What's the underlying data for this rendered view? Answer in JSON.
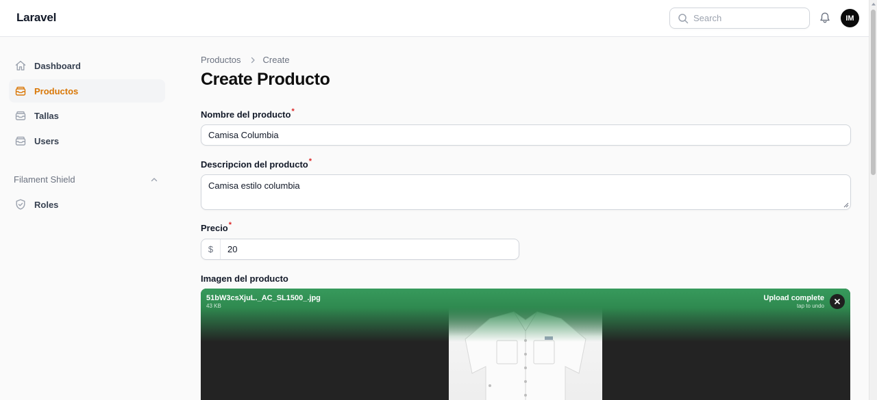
{
  "app": {
    "brand": "Laravel"
  },
  "header": {
    "search_placeholder": "Search",
    "avatar_initials": "IM"
  },
  "sidebar": {
    "items": [
      {
        "label": "Dashboard",
        "icon": "home-icon",
        "active": false
      },
      {
        "label": "Productos",
        "icon": "inbox-stack-icon",
        "active": true
      },
      {
        "label": "Tallas",
        "icon": "inbox-stack-icon",
        "active": false
      },
      {
        "label": "Users",
        "icon": "inbox-stack-icon",
        "active": false
      }
    ],
    "group": {
      "label": "Filament Shield",
      "items": [
        {
          "label": "Roles",
          "icon": "shield-check-icon"
        }
      ]
    }
  },
  "breadcrumb": {
    "parent": "Productos",
    "current": "Create"
  },
  "page": {
    "title": "Create Producto"
  },
  "form": {
    "nombre": {
      "label": "Nombre del producto",
      "required": "*",
      "value": "Camisa Columbia"
    },
    "descripcion": {
      "label": "Descripcion del producto",
      "required": "*",
      "value": "Camisa estilo columbia"
    },
    "precio": {
      "label": "Precio",
      "required": "*",
      "prefix": "$",
      "value": "20"
    },
    "imagen": {
      "label": "Imagen del producto",
      "file_name": "51bW3csXjuL._AC_SL1500_.jpg",
      "file_size": "43 KB",
      "status": "Upload complete",
      "status_hint": "tap to undo"
    }
  },
  "colors": {
    "accent": "#d97706",
    "upload_success": "#379a5c",
    "required": "#dc2626"
  }
}
